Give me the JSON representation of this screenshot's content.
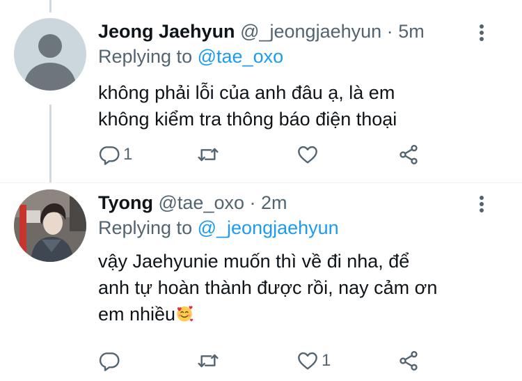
{
  "tweets": [
    {
      "display_name": "Jeong Jaehyun",
      "handle": "@_jeongjaehyun",
      "separator": "·",
      "time": "5m",
      "replying_prefix": "Replying to",
      "replying_to": "@tae_oxo",
      "text_lines": [
        "không phải lỗi của anh đâu ạ, là em",
        "không kiểm tra thông báo điện thoại"
      ],
      "reply_count": "1",
      "retweet_count": "",
      "like_count": "",
      "avatar_icon": "default-profile-avatar"
    },
    {
      "display_name": "Tyong",
      "handle": "@tae_oxo",
      "separator": "·",
      "time": "2m",
      "replying_prefix": "Replying to",
      "replying_to": "@_jeongjaehyun",
      "text_lines": [
        "vậy Jaehyunie muốn thì về đi nha, để",
        "anh tự hoàn thành được rồi, nay cảm ơn",
        "em nhiều"
      ],
      "emoji": "smiling-face-with-hearts",
      "reply_count": "",
      "retweet_count": "",
      "like_count": "1",
      "avatar_icon": "profile-photo"
    }
  ],
  "colors": {
    "text_primary": "#0f1419",
    "text_secondary": "#536471",
    "link": "#1d9bf0",
    "thread_line": "#cfd9de",
    "avatar_placeholder_bg": "#ccd6dd",
    "avatar_placeholder_fg": "#6e767d"
  },
  "icons": {
    "reply": "reply-icon",
    "retweet": "retweet-icon",
    "like": "heart-icon",
    "share": "share-icon",
    "more": "more-vertical-icon"
  }
}
